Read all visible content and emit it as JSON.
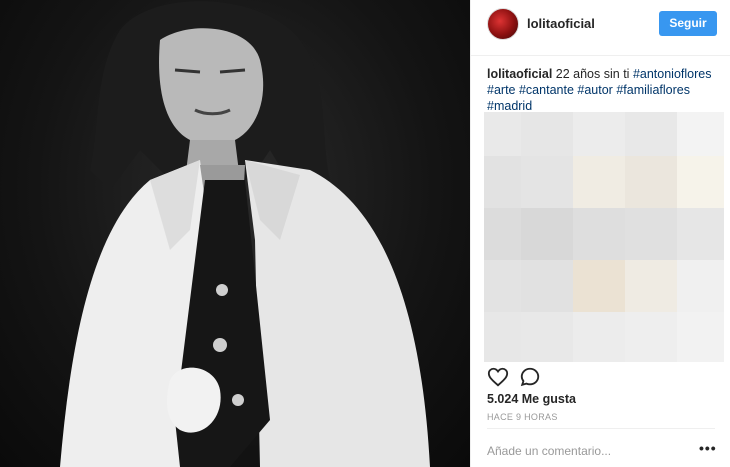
{
  "post": {
    "username": "lolitaoficial",
    "follow_label": "Seguir",
    "caption": {
      "username": "lolitaoficial",
      "text": "22 años sin ti",
      "hashtags": [
        "#antonioflores",
        "#arte",
        "#cantante",
        "#autor",
        "#familiaflores",
        "#madrid"
      ]
    },
    "likes": "5.024 Me gusta",
    "time": "HACE 9 HORAS",
    "comment_placeholder": "Añade un comentario...",
    "more_label": "•••"
  },
  "icons": {
    "like": "heart-icon",
    "comment": "comment-icon",
    "more": "more-options-icon"
  },
  "colors": {
    "follow_button": "#3897f0",
    "hashtag": "#003569",
    "muted_text": "#999999"
  }
}
